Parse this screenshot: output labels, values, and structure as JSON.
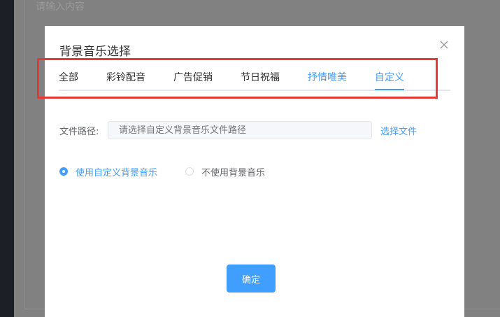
{
  "background": {
    "input_placeholder": "请输入内容"
  },
  "dialog": {
    "title": "背景音乐选择",
    "close_icon": "close-icon",
    "tabs": [
      {
        "label": "全部"
      },
      {
        "label": "彩铃配音"
      },
      {
        "label": "广告促销"
      },
      {
        "label": "节日祝福"
      },
      {
        "label": "抒情唯美"
      },
      {
        "label": "自定义"
      }
    ],
    "active_tab": "自定义",
    "file_path": {
      "label": "文件路径:",
      "placeholder": "请选择自定义背景音乐文件路径",
      "value": "",
      "choose_label": "选择文件"
    },
    "radios": [
      {
        "label": "使用自定义背景音乐",
        "checked": true
      },
      {
        "label": "不使用背景音乐",
        "checked": false
      }
    ],
    "confirm_label": "确定"
  },
  "colors": {
    "accent": "#409eff",
    "annotation": "#e53935",
    "overlay": "#818181"
  }
}
